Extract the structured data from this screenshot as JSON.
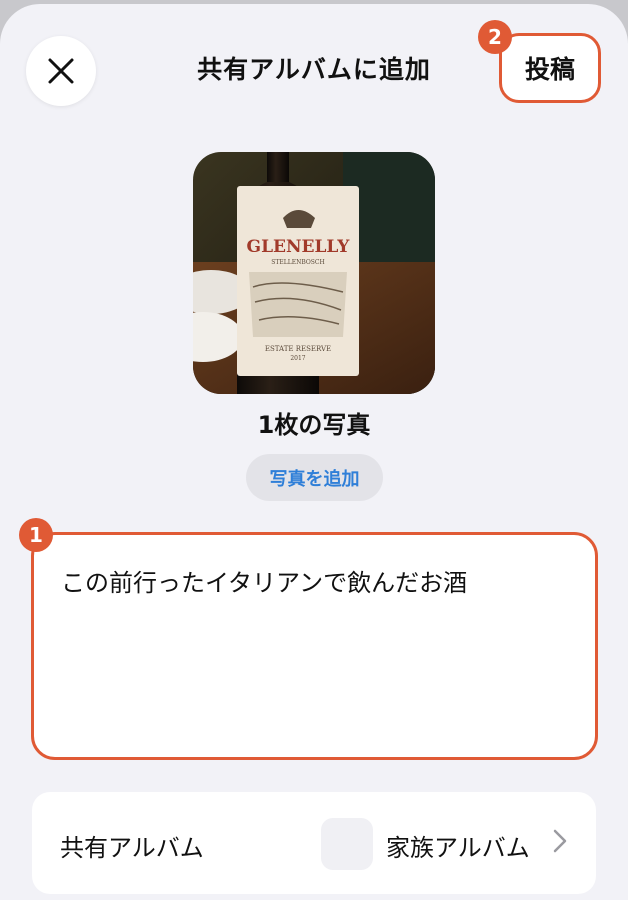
{
  "header": {
    "title": "共有アルバムに追加",
    "post_label": "投稿"
  },
  "annotations": {
    "badge_1": "1",
    "badge_2": "2"
  },
  "photo": {
    "count_label": "1枚の写真",
    "add_photo_label": "写真を追加",
    "bottle_brand": "GLENELLY",
    "bottle_origin": "STELLENBOSCH",
    "bottle_line": "ESTATE RESERVE",
    "bottle_year": "2017"
  },
  "caption": {
    "text": "この前行ったイタリアンで飲んだお酒"
  },
  "album_row": {
    "label": "共有アルバム",
    "value": "家族アルバム"
  },
  "colors": {
    "accent_highlight": "#e05a35",
    "link_blue": "#2f7fd8",
    "sheet_bg": "#f2f2f7"
  },
  "icons": {
    "close": "close-icon",
    "chevron": "chevron-right-icon"
  }
}
